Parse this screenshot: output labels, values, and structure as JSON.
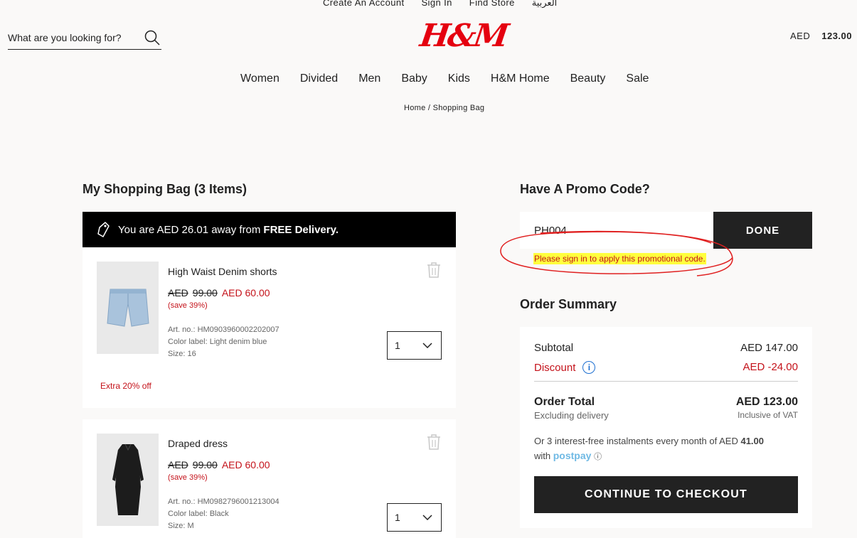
{
  "top_links": [
    "Create An Account",
    "Sign In",
    "Find Store",
    "العربية"
  ],
  "search": {
    "placeholder": "What are you looking for?"
  },
  "logo_text": "H&M",
  "cart": {
    "currency": "AED",
    "amount": "123.00"
  },
  "nav": [
    "Women",
    "Divided",
    "Men",
    "Baby",
    "Kids",
    "H&M Home",
    "Beauty",
    "Sale"
  ],
  "breadcrumb": "Home / Shopping Bag",
  "bag": {
    "title": "My Shopping Bag (3 Items)",
    "free_delivery_text": "You are AED 26.01 away from",
    "free_delivery_bold": "FREE Delivery.",
    "items": [
      {
        "name": "High Waist Denim shorts",
        "old_currency": "AED",
        "old_price": "99.00",
        "new_price": "AED  60.00",
        "save": "(save 39%)",
        "art_no": "Art. no.: HM0903960002202007",
        "color": "Color label: Light denim blue",
        "size": "Size: 16",
        "qty": "1",
        "extra": "Extra 20% off"
      },
      {
        "name": "Draped dress",
        "old_currency": "AED",
        "old_price": "99.00",
        "new_price": "AED  60.00",
        "save": "(save 39%)",
        "art_no": "Art. no.: HM0982796001213004",
        "color": "Color label: Black",
        "size": "Size: M",
        "qty": "1"
      }
    ]
  },
  "promo": {
    "title": "Have A Promo Code?",
    "value": "PH004",
    "button": "DONE",
    "error": "Please sign in to apply this promotional code."
  },
  "summary": {
    "title": "Order Summary",
    "subtotal_label": "Subtotal",
    "subtotal_value": "AED 147.00",
    "discount_label": "Discount",
    "discount_value": "AED -24.00",
    "total_label": "Order Total",
    "total_value": "AED 123.00",
    "excluding": "Excluding delivery",
    "inclusive": "Inclusive of VAT",
    "postpay_line1": "Or 3 interest-free instalments every month of AED",
    "postpay_amount": "41.00",
    "postpay_with": "with",
    "postpay_brand": "postpay",
    "checkout": "CONTINUE TO CHECKOUT"
  },
  "colors": {
    "brand_red": "#e50010",
    "sale_red": "#c4121a",
    "dark": "#222222",
    "highlight": "#ffff3d"
  }
}
